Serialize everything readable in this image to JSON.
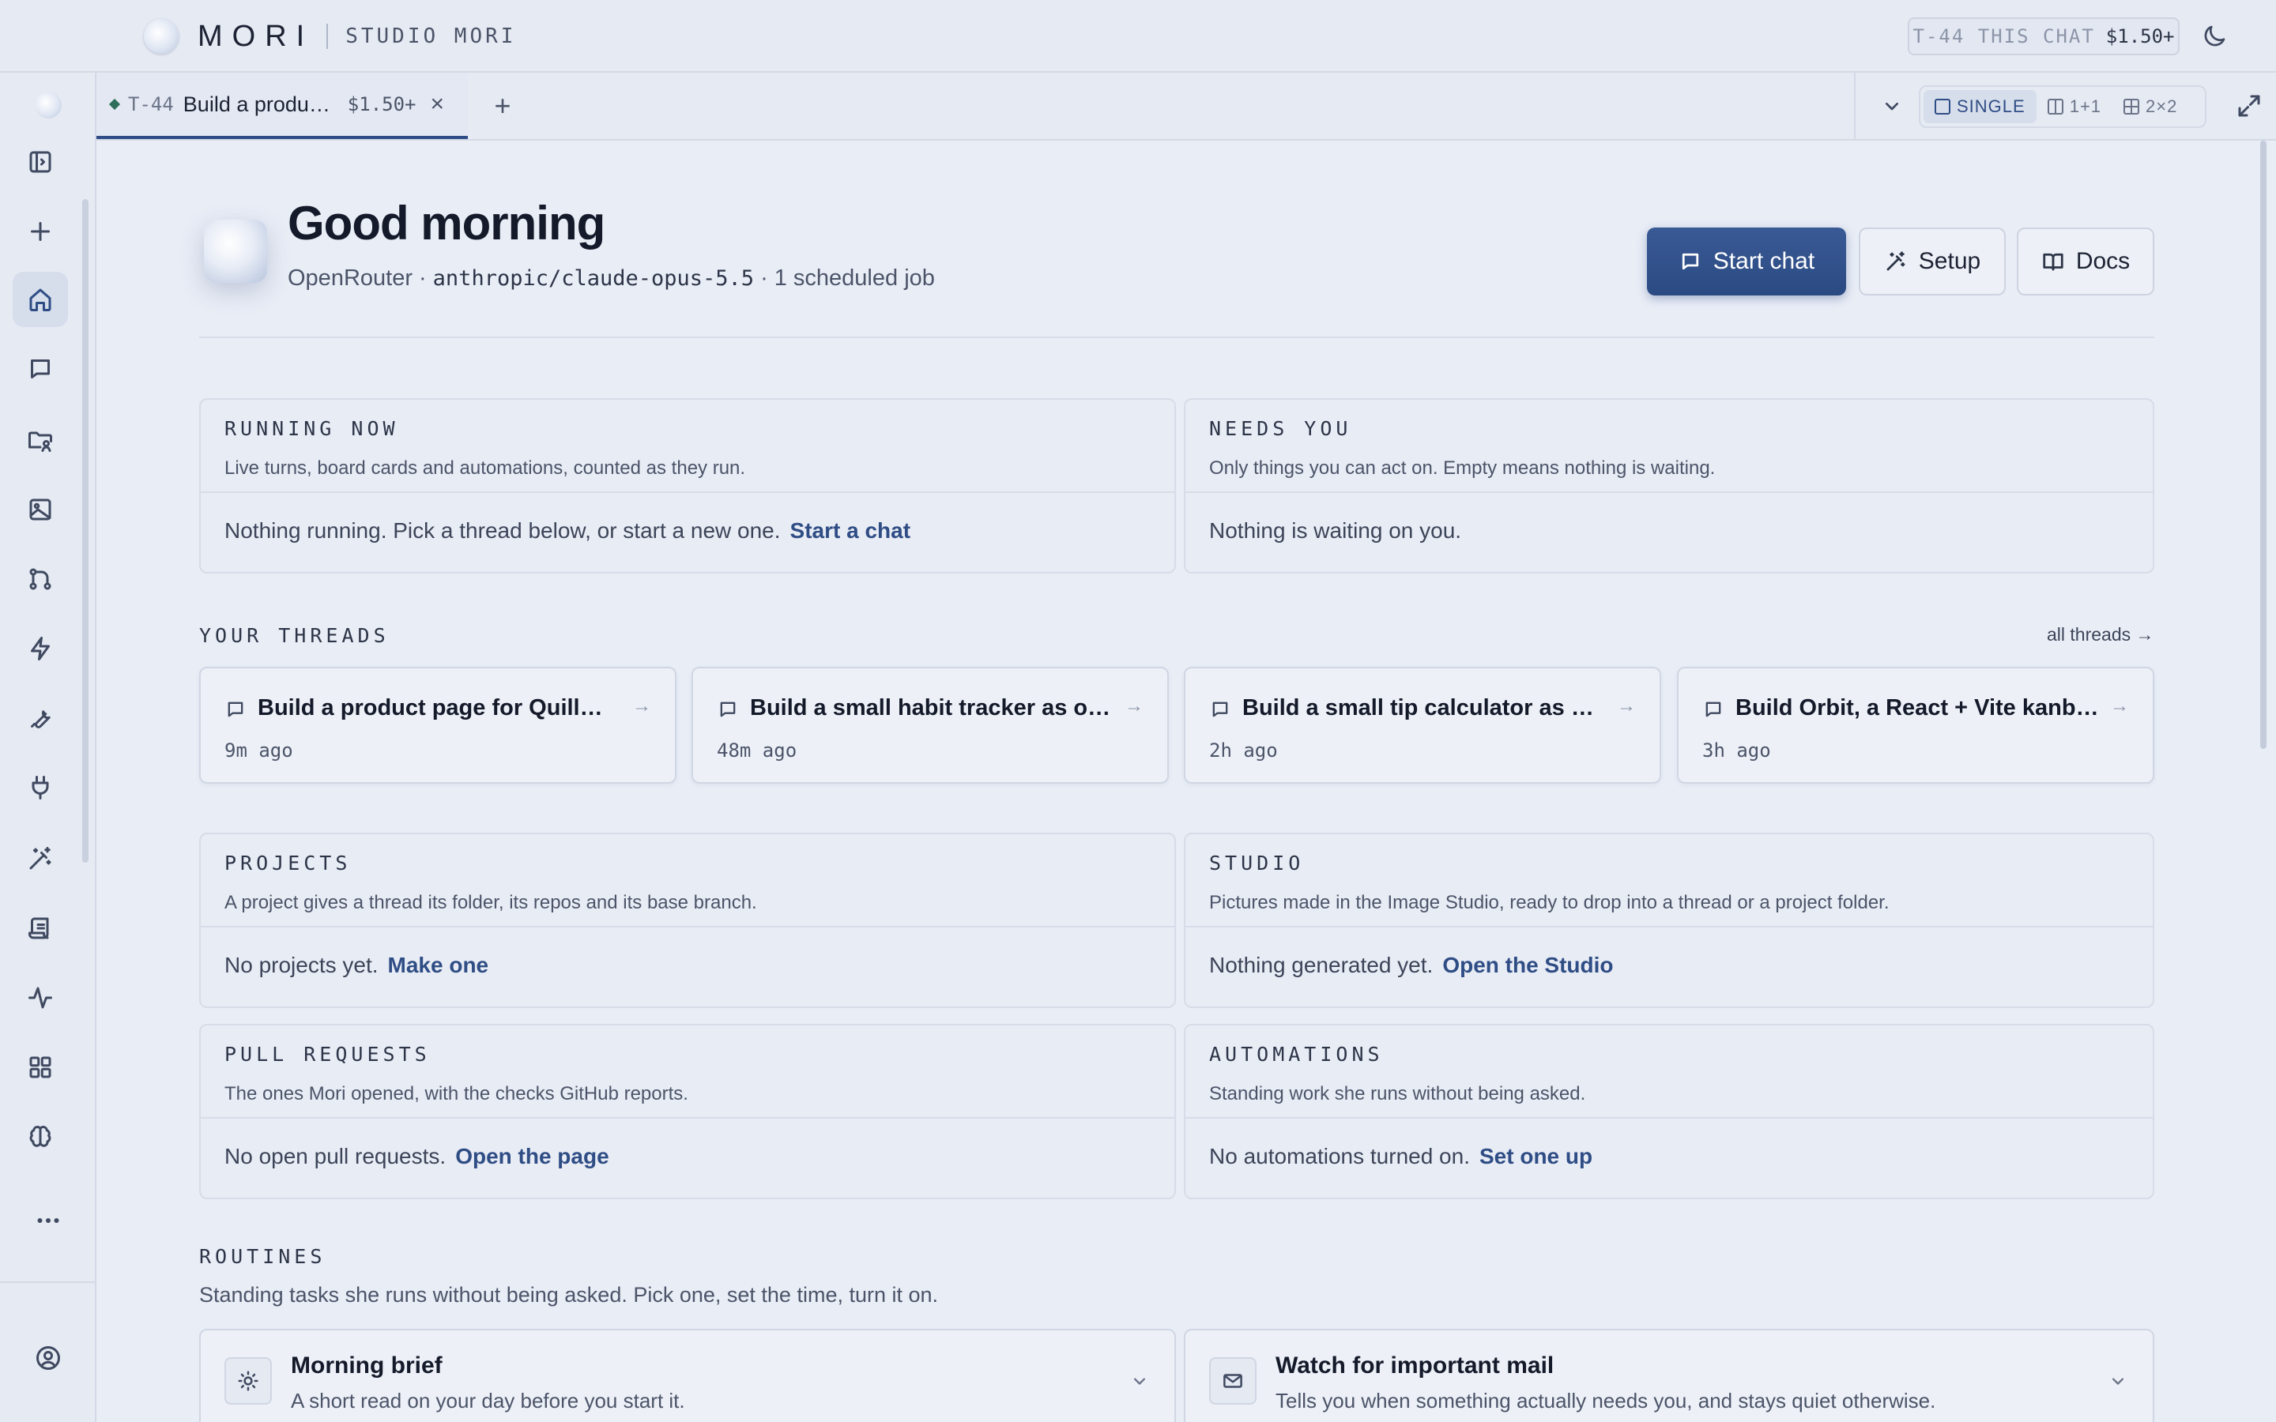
{
  "app": {
    "brand_name": "MORI",
    "workspace": "STUDIO MORI",
    "cost_label": "T-44 THIS CHAT",
    "cost_value": "$1.50+"
  },
  "rail": {
    "items": [
      {
        "name": "toggle-sidebar",
        "icon": "sidebar-icon"
      },
      {
        "name": "new",
        "icon": "plus-icon"
      },
      {
        "name": "home",
        "icon": "home-icon",
        "active": true
      },
      {
        "name": "chats",
        "icon": "chat-icon"
      },
      {
        "name": "projects",
        "icon": "folder-user-icon"
      },
      {
        "name": "studio",
        "icon": "image-icon"
      },
      {
        "name": "pull-requests",
        "icon": "git-branch-icon"
      },
      {
        "name": "automations",
        "icon": "bolt-icon"
      },
      {
        "name": "tools",
        "icon": "wrench-icon"
      },
      {
        "name": "plugins",
        "icon": "plug-icon"
      },
      {
        "name": "magic",
        "icon": "wand-icon"
      },
      {
        "name": "logs",
        "icon": "scroll-icon"
      },
      {
        "name": "activity",
        "icon": "pulse-icon"
      },
      {
        "name": "apps",
        "icon": "grid-icon"
      },
      {
        "name": "memory",
        "icon": "brain-icon"
      },
      {
        "name": "more",
        "icon": "more-icon"
      },
      {
        "name": "account",
        "icon": "user-circle-icon"
      }
    ]
  },
  "tabs": {
    "items": [
      {
        "id": "T-44",
        "title": "Build a product page for Quillmoor...",
        "cost": "$1.50+"
      }
    ],
    "layouts": [
      {
        "label": "SINGLE",
        "active": true
      },
      {
        "label": "1+1",
        "active": false
      },
      {
        "label": "2×2",
        "active": false
      }
    ]
  },
  "hero": {
    "greeting": "Good morning",
    "provider": "OpenRouter",
    "sep1": "·",
    "model": "anthropic/claude-opus-5.5",
    "sep2": "·",
    "jobs": "1 scheduled job",
    "start_chat": "Start chat",
    "setup": "Setup",
    "docs": "Docs"
  },
  "running": {
    "label": "RUNNING NOW",
    "desc": "Live turns, board cards and automations, counted as they run.",
    "body": "Nothing running. Pick a thread below, or start a new one.",
    "link": "Start a chat"
  },
  "needs": {
    "label": "NEEDS YOU",
    "desc": "Only things you can act on. Empty means nothing is waiting.",
    "body": "Nothing is waiting on you."
  },
  "threads": {
    "label": "YOUR THREADS",
    "all": "all threads →",
    "items": [
      {
        "title": "Build a product page for Quillmoor...",
        "time": "9m ago"
      },
      {
        "title": "Build a small habit tracker as one s...",
        "time": "48m ago"
      },
      {
        "title": "Build a small tip calculator as one s...",
        "time": "2h ago"
      },
      {
        "title": "Build Orbit, a React + Vite kanban a...",
        "time": "3h ago"
      }
    ]
  },
  "projects": {
    "label": "PROJECTS",
    "desc": "A project gives a thread its folder, its repos and its base branch.",
    "body": "No projects yet.",
    "link": "Make one"
  },
  "studio": {
    "label": "STUDIO",
    "desc": "Pictures made in the Image Studio, ready to drop into a thread or a project folder.",
    "body": "Nothing generated yet.",
    "link": "Open the Studio"
  },
  "prs": {
    "label": "PULL REQUESTS",
    "desc": "The ones Mori opened, with the checks GitHub reports.",
    "body": "No open pull requests.",
    "link": "Open the page"
  },
  "automations": {
    "label": "AUTOMATIONS",
    "desc": "Standing work she runs without being asked.",
    "body": "No automations turned on.",
    "link": "Set one up"
  },
  "routines": {
    "label": "ROUTINES",
    "desc": "Standing tasks she runs without being asked. Pick one, set the time, turn it on.",
    "items": [
      {
        "title": "Morning brief",
        "desc": "A short read on your day before you start it.",
        "icon": "sun-icon"
      },
      {
        "title": "Watch for important mail",
        "desc": "Tells you when something actually needs you, and stays quiet otherwise.",
        "icon": "mail-icon"
      }
    ]
  },
  "colors": {
    "accent": "#2f4d85",
    "background": "#e9edf6",
    "border": "#d7dce8"
  }
}
